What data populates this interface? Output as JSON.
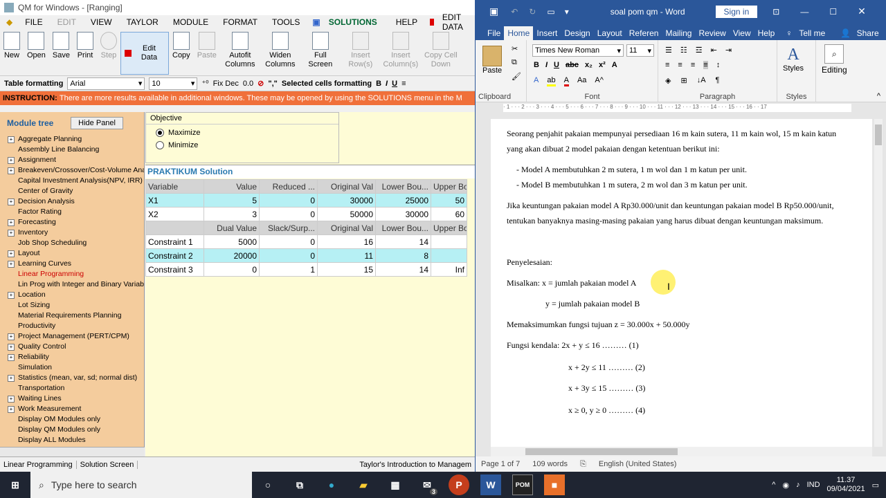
{
  "qm": {
    "title": "QM for Windows - [Ranging]",
    "menu": [
      {
        "l": "FILE",
        "dis": false
      },
      {
        "l": "EDIT",
        "dis": true
      },
      {
        "l": "VIEW",
        "dis": false
      },
      {
        "l": "TAYLOR",
        "dis": false
      },
      {
        "l": "MODULE",
        "dis": false
      },
      {
        "l": "FORMAT",
        "dis": false
      },
      {
        "l": "TOOLS",
        "dis": false
      }
    ],
    "menu_solutions": "SOLUTIONS",
    "menu_help": "HELP",
    "menu_editdata": "EDIT DATA",
    "tools": [
      "New",
      "Open",
      "Save",
      "Print"
    ],
    "step": "Step",
    "edit_data": "Edit Data",
    "tools2": [
      {
        "l": "Copy",
        "dis": false
      },
      {
        "l": "Paste",
        "dis": true
      },
      {
        "l": "Autofit Columns",
        "dis": false
      },
      {
        "l": "Widen Columns",
        "dis": false
      },
      {
        "l": "Full Screen",
        "dis": false
      },
      {
        "l": "Insert Row(s)",
        "dis": true
      },
      {
        "l": "Insert Column(s)",
        "dis": true
      },
      {
        "l": "Copy Cell Down",
        "dis": true
      }
    ],
    "fmt_label": "Table formatting",
    "font": "Arial",
    "size": "10",
    "fixdec": "Fix Dec",
    "fixval": "0.0",
    "sel_fmt": "Selected cells formatting",
    "instruction_label": "INSTRUCTION:",
    "instruction": "There are more results available in additional windows. These may be opened by using the SOLUTIONS menu in the M",
    "module_tree": "Module tree",
    "hide_panel": "Hide Panel",
    "modules": [
      {
        "l": "Aggregate Planning",
        "e": true
      },
      {
        "l": "Assembly Line Balancing",
        "e": false
      },
      {
        "l": "Assignment",
        "e": true
      },
      {
        "l": "Breakeven/Crossover/Cost-Volume Analy",
        "e": true
      },
      {
        "l": "Capital Investment Analysis(NPV, IRR)",
        "e": false
      },
      {
        "l": "Center of Gravity",
        "e": false
      },
      {
        "l": "Decision Analysis",
        "e": true
      },
      {
        "l": "Factor Rating",
        "e": false
      },
      {
        "l": "Forecasting",
        "e": true
      },
      {
        "l": "Inventory",
        "e": true
      },
      {
        "l": "Job Shop Scheduling",
        "e": false
      },
      {
        "l": "Layout",
        "e": true
      },
      {
        "l": "Learning Curves",
        "e": true
      },
      {
        "l": "Linear Programming",
        "e": false,
        "a": true
      },
      {
        "l": "Lin Prog with Integer and Binary Variables",
        "e": false
      },
      {
        "l": "Location",
        "e": true
      },
      {
        "l": "Lot Sizing",
        "e": false
      },
      {
        "l": "Material Requirements Planning",
        "e": false
      },
      {
        "l": "Productivity",
        "e": false
      },
      {
        "l": "Project Management (PERT/CPM)",
        "e": true
      },
      {
        "l": "Quality Control",
        "e": true
      },
      {
        "l": "Reliability",
        "e": true
      },
      {
        "l": "Simulation",
        "e": false
      },
      {
        "l": "Statistics (mean, var, sd; normal dist)",
        "e": true
      },
      {
        "l": "Transportation",
        "e": false
      },
      {
        "l": "Waiting Lines",
        "e": true
      },
      {
        "l": "Work Measurement",
        "e": true
      },
      {
        "l": "Display OM Modules only",
        "e": false
      },
      {
        "l": "Display QM Modules only",
        "e": false
      },
      {
        "l": "Display ALL Modules",
        "e": false
      }
    ],
    "objective": "Objective",
    "maximize": "Maximize",
    "minimize": "Minimize",
    "solution_title": "PRAKTIKUM Solution",
    "h1": [
      "Variable",
      "Value",
      "Reduced ...",
      "Original Val",
      "Lower Bou...",
      "Upper Bo"
    ],
    "rows1": [
      [
        "X1",
        "5",
        "0",
        "30000",
        "25000",
        "50"
      ],
      [
        "X2",
        "3",
        "0",
        "50000",
        "30000",
        "60"
      ]
    ],
    "h2": [
      "",
      "Dual Value",
      "Slack/Surp...",
      "Original Val",
      "Lower Bou...",
      "Upper Bo"
    ],
    "rows2": [
      [
        "Constraint 1",
        "5000",
        "0",
        "16",
        "14",
        ""
      ],
      [
        "Constraint 2",
        "20000",
        "0",
        "11",
        "8",
        ""
      ],
      [
        "Constraint 3",
        "0",
        "1",
        "15",
        "14",
        "Inf"
      ]
    ],
    "status": [
      "Linear Programming",
      "Solution Screen",
      "Taylor's Introduction to Managem"
    ]
  },
  "word": {
    "title": "soal pom qm  -  Word",
    "signin": "Sign in",
    "tabs": [
      "File",
      "Home",
      "Insert",
      "Design",
      "Layout",
      "Referen",
      "Mailing",
      "Review",
      "View",
      "Help"
    ],
    "tellme": "Tell me",
    "share": "Share",
    "paste": "Paste",
    "font": "Times New Roman",
    "size": "11",
    "styles": "Styles",
    "editing": "Editing",
    "groups": [
      "Clipboard",
      "Font",
      "Paragraph",
      "Styles"
    ],
    "ruler": "· 1 · · · 2 · · · 3 · · · 4 · · · 5 · · · 6 · · · 7 · · · 8 · · · 9 · · · 10 · · · 11 · · · 12 · · · 13 · · · 14 · · · 15 · · · 16 · · 17",
    "lines": [
      "Seorang penjahit pakaian mempunyai persediaan 16 m kain sutera, 11 m kain wol, 15 m kain katun",
      "yang akan dibuat 2 model pakaian dengan ketentuan berikut ini:",
      "-      Model A membutuhkan 2 m sutera, 1 m wol dan 1 m katun per unit.",
      "-      Model B membutuhkan 1 m sutera, 2 m wol dan 3 m katun per unit.",
      "Jika keuntungan pakaian model A Rp30.000/unit dan keuntungan pakaian model B Rp50.000/unit,",
      "tentukan banyaknya masing-masing pakaian yang harus dibuat dengan keuntungan maksimum.",
      "Penyelesaian:",
      "Misalkan:  x = jumlah pakaian model A",
      "y = jumlah pakaian model B",
      "Memaksimumkan fungsi tujuan z = 30.000x + 50.000y",
      "Fungsi kendala:   2x + y ≤ 16 ……… (1)",
      "x + 2y ≤ 11 ……… (2)",
      "x + 3y ≤ 15 ……… (3)",
      "x ≥ 0, y ≥ 0 ……… (4)"
    ],
    "status": [
      "Page 1 of 7",
      "109 words",
      "English (United States)"
    ]
  },
  "taskbar": {
    "search": "Type here to search",
    "lang": "IND",
    "time": "11.37",
    "date": "09/04/2021",
    "badge": "3"
  }
}
